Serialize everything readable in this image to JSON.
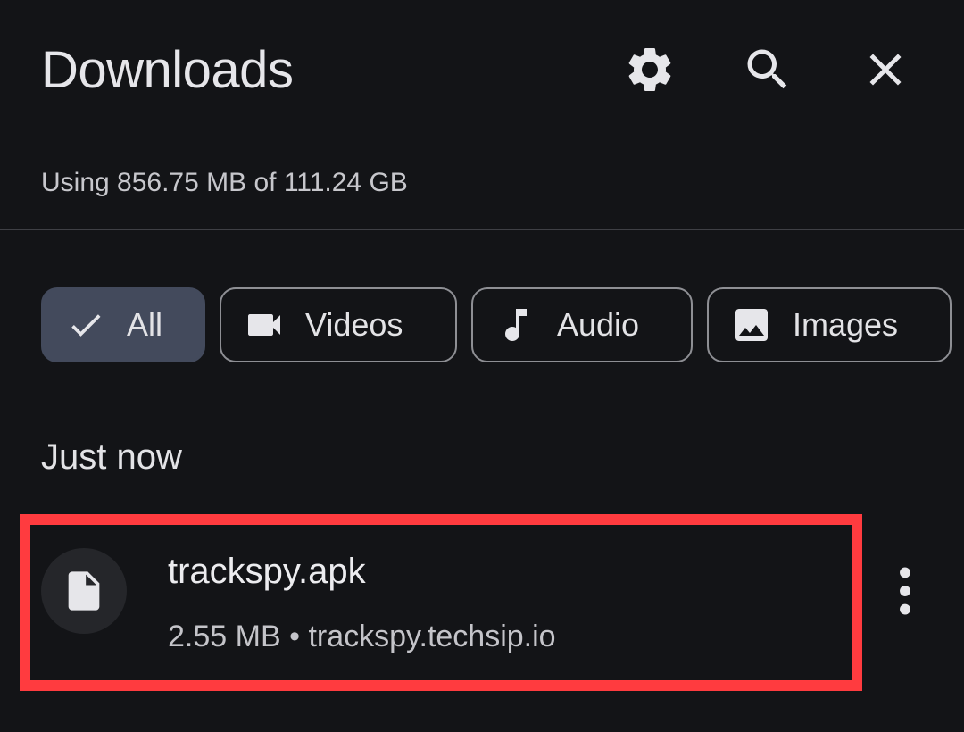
{
  "header": {
    "title": "Downloads",
    "icons": [
      "gear-icon",
      "search-icon",
      "close-icon"
    ]
  },
  "storage": {
    "text": "Using 856.75 MB of 111.24 GB"
  },
  "filters": [
    {
      "label": "All",
      "icon": "check-icon",
      "selected": true
    },
    {
      "label": "Videos",
      "icon": "video-camera-icon",
      "selected": false
    },
    {
      "label": "Audio",
      "icon": "music-note-icon",
      "selected": false
    },
    {
      "label": "Images",
      "icon": "image-icon",
      "selected": false
    }
  ],
  "sections": [
    {
      "label": "Just now",
      "items": [
        {
          "name": "trackspy.apk",
          "size": "2.55 MB",
          "separator": "•",
          "source": "trackspy.techsip.io",
          "icon": "file-icon"
        }
      ]
    }
  ],
  "colors": {
    "background": "#131417",
    "selected_chip": "#434a5c",
    "highlight_border": "#ff3b3f"
  }
}
